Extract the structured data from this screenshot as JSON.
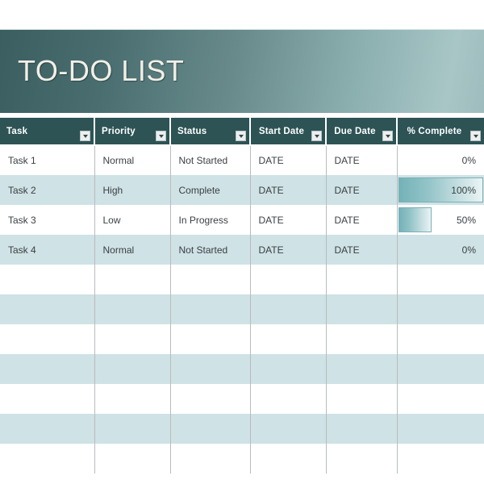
{
  "banner": {
    "title": "TO-DO LIST",
    "gradient_from": "#3b5e60",
    "gradient_to": "#a8c6c6"
  },
  "table": {
    "header_bg": "#2d5355",
    "band_color": "#cfe2e5",
    "databar_color": "#74b2b8",
    "columns": [
      {
        "label": "Task",
        "align": "left",
        "filter": true
      },
      {
        "label": "Priority",
        "align": "left",
        "filter": true
      },
      {
        "label": "Status",
        "align": "left",
        "filter": true
      },
      {
        "label": "Start Date",
        "align": "center",
        "filter": true
      },
      {
        "label": "Due Date",
        "align": "center",
        "filter": true
      },
      {
        "label": "% Complete",
        "align": "center",
        "filter": true
      }
    ],
    "rows": [
      {
        "task": "Task 1",
        "priority": "Normal",
        "status": "Not Started",
        "start_date": "DATE",
        "due_date": "DATE",
        "percent_complete": "0%",
        "percent_value": 0
      },
      {
        "task": "Task 2",
        "priority": "High",
        "status": "Complete",
        "start_date": "DATE",
        "due_date": "DATE",
        "percent_complete": "100%",
        "percent_value": 100
      },
      {
        "task": "Task 3",
        "priority": "Low",
        "status": "In Progress",
        "start_date": "DATE",
        "due_date": "DATE",
        "percent_complete": "50%",
        "percent_value": 50
      },
      {
        "task": "Task 4",
        "priority": "Normal",
        "status": "Not Started",
        "start_date": "DATE",
        "due_date": "DATE",
        "percent_complete": "0%",
        "percent_value": 0
      },
      {
        "task": "",
        "priority": "",
        "status": "",
        "start_date": "",
        "due_date": "",
        "percent_complete": "",
        "percent_value": null
      },
      {
        "task": "",
        "priority": "",
        "status": "",
        "start_date": "",
        "due_date": "",
        "percent_complete": "",
        "percent_value": null
      },
      {
        "task": "",
        "priority": "",
        "status": "",
        "start_date": "",
        "due_date": "",
        "percent_complete": "",
        "percent_value": null
      },
      {
        "task": "",
        "priority": "",
        "status": "",
        "start_date": "",
        "due_date": "",
        "percent_complete": "",
        "percent_value": null
      },
      {
        "task": "",
        "priority": "",
        "status": "",
        "start_date": "",
        "due_date": "",
        "percent_complete": "",
        "percent_value": null
      },
      {
        "task": "",
        "priority": "",
        "status": "",
        "start_date": "",
        "due_date": "",
        "percent_complete": "",
        "percent_value": null
      },
      {
        "task": "",
        "priority": "",
        "status": "",
        "start_date": "",
        "due_date": "",
        "percent_complete": "",
        "percent_value": null
      }
    ]
  }
}
